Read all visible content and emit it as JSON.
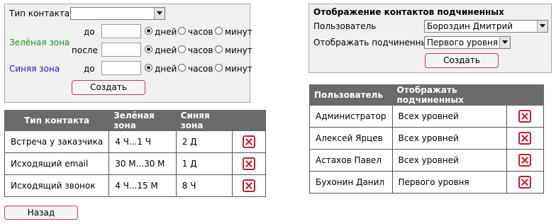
{
  "left_panel": {
    "contact_type_label": "Тип контакта",
    "contact_type_value": "",
    "green_zone_label": "Зелёная зона",
    "blue_zone_label": "Синяя зона",
    "from_label": "до",
    "after_label": "после",
    "units": [
      "дней",
      "часов",
      "минут"
    ],
    "create_label": "Создать"
  },
  "contacts_table": {
    "headers": [
      "Тип контакта",
      "Зелёная зона",
      "Синяя зона",
      ""
    ],
    "rows": [
      {
        "type": "Встреча у заказчика",
        "green": "4 Ч...1 Ч",
        "blue": "2 Д"
      },
      {
        "type": "Исходящий email",
        "green": "30 М...30 М",
        "blue": "1 Д"
      },
      {
        "type": "Исходящий звонок",
        "green": "4 Ч...15 М",
        "blue": "8 Ч"
      }
    ]
  },
  "right_panel": {
    "title": "Отображение контактов подчиненных",
    "user_label": "Пользователь",
    "user_value": "Бороздин Дмитрий",
    "show_label": "Отображать подчиненных",
    "show_value": "Первого уровня",
    "create_label": "Создать"
  },
  "subordinates_table": {
    "headers": [
      "Пользователь",
      "Отображать подчиненных",
      ""
    ],
    "rows": [
      {
        "user": "Администратор",
        "show": "Всех уровней"
      },
      {
        "user": "Алексей Ярцев",
        "show": "Всех уровней"
      },
      {
        "user": "Астахов Павел",
        "show": "Всех уровней"
      },
      {
        "user": "Бухонин Данил",
        "show": "Первого уровня"
      }
    ]
  },
  "back_label": "Назад",
  "colors": {
    "green": "#2a8a2a",
    "blue": "#1a1acc",
    "delete": "#c02030",
    "header": "#6a6a6a"
  }
}
